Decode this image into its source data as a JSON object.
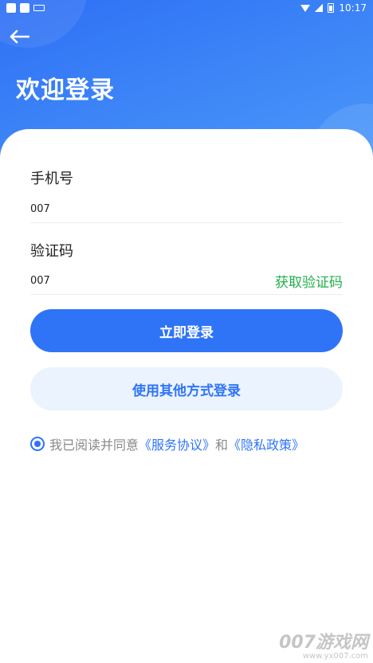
{
  "status_bar": {
    "time": "10:17"
  },
  "header": {
    "title": "欢迎登录"
  },
  "form": {
    "phone_label": "手机号",
    "phone_value": "007",
    "code_label": "验证码",
    "code_value": "007",
    "get_code_label": "获取验证码"
  },
  "actions": {
    "login_label": "立即登录",
    "other_login_label": "使用其他方式登录"
  },
  "agreement": {
    "prefix": "我已阅读并同意",
    "service_link": "《服务协议》",
    "joiner": "和",
    "privacy_link": "《隐私政策》",
    "checked": true
  },
  "watermark": {
    "main": "007游戏网",
    "sub": "www.yx007.com"
  },
  "colors": {
    "primary": "#2f74f6",
    "accent_green": "#22b04b",
    "secondary_bg": "#eaf3fe"
  }
}
